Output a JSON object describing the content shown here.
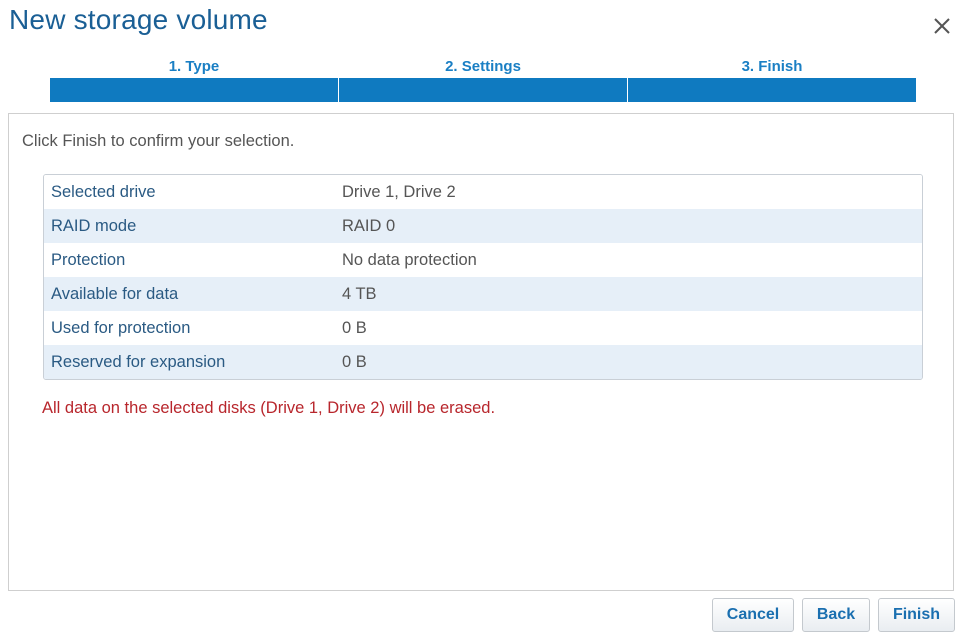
{
  "dialog": {
    "title": "New storage volume",
    "close_icon": "close-icon"
  },
  "wizard": {
    "steps": [
      {
        "label": "1. Type"
      },
      {
        "label": "2. Settings"
      },
      {
        "label": "3. Finish"
      }
    ],
    "accent_color": "#0f7ac0"
  },
  "content": {
    "intro": "Click Finish to confirm your selection.",
    "summary": [
      {
        "key": "Selected drive",
        "value": "Drive 1, Drive 2"
      },
      {
        "key": "RAID mode",
        "value": "RAID 0"
      },
      {
        "key": "Protection",
        "value": "No data protection"
      },
      {
        "key": "Available for data",
        "value": "4 TB"
      },
      {
        "key": "Used for protection",
        "value": "0 B"
      },
      {
        "key": "Reserved for expansion",
        "value": "0 B"
      }
    ],
    "warning": "All data on the selected disks (Drive 1, Drive 2) will be erased.",
    "warning_color": "#b8262c"
  },
  "footer": {
    "cancel_label": "Cancel",
    "back_label": "Back",
    "finish_label": "Finish"
  }
}
